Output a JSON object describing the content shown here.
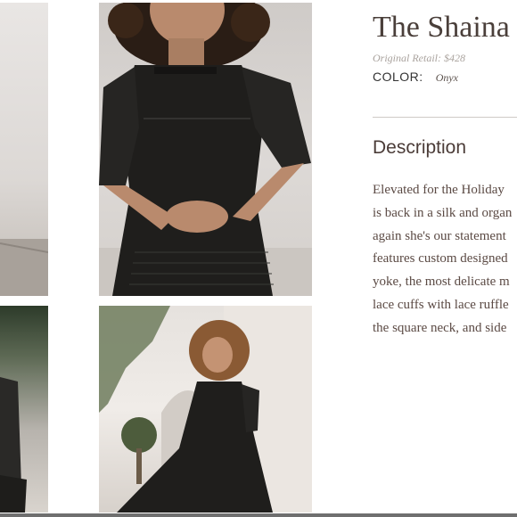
{
  "product": {
    "title": "The Shaina",
    "original_retail": "Original Retail: $428",
    "color_label": "COLOR:",
    "color_value": "Onyx"
  },
  "description": {
    "heading": "Description",
    "lines": [
      "Elevated for the Holiday",
      "is back in a silk and organ",
      "again she's our statement",
      "features custom designed",
      "yoke, the most delicate m",
      "lace cuffs with lace ruffle",
      "the square neck, and side"
    ]
  },
  "gallery": {
    "images": [
      "partial-cropped-photo",
      "model-black-dress-closeup",
      "partial-model-photo",
      "model-black-dress-full-length"
    ]
  },
  "colors": {
    "title": "#4a3f3a",
    "dress": "#1f1e1c",
    "text": "#5b4a44",
    "divider": "#cfcac6"
  }
}
